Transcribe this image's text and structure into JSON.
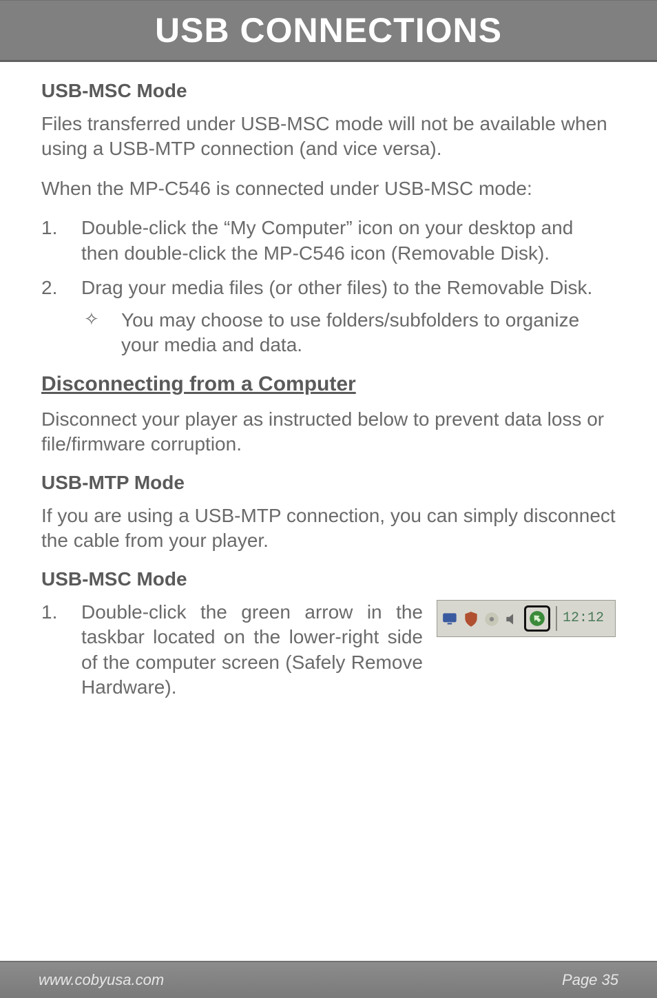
{
  "header": {
    "title": "USB CONNECTIONS"
  },
  "sections": {
    "usb_msc_mode_1": {
      "heading": "USB-MSC Mode",
      "p1": "Files transferred under USB-MSC mode will not be available when using a USB-MTP connection (and vice versa).",
      "p2": "When the MP-C546 is connected under USB-MSC mode:",
      "list": [
        {
          "num": "1.",
          "text": "Double-click the “My Computer” icon on your desktop and then double-click the MP-C546 icon (Removable Disk)."
        },
        {
          "num": "2.",
          "text": "Drag your media files (or other files) to the Removable Disk.",
          "sub": [
            {
              "bullet": "✧",
              "text": "You may choose to use folders/subfolders to organize your media and data."
            }
          ]
        }
      ]
    },
    "disconnecting": {
      "heading": "Disconnecting from a Computer",
      "p1": "Disconnect your player as instructed below to prevent data loss or file/firmware corruption."
    },
    "usb_mtp_mode": {
      "heading": "USB-MTP Mode",
      "p1": "If you are using a USB-MTP connection, you can simply disconnect the cable from your player."
    },
    "usb_msc_mode_2": {
      "heading": "USB-MSC Mode",
      "list": [
        {
          "num": "1.",
          "text": "Double-click the green arrow in the taskbar located on the lower-right side of the computer screen (Safely Remove Hardware)."
        }
      ]
    }
  },
  "tray": {
    "clock": "12:12"
  },
  "footer": {
    "left": "www.cobyusa.com",
    "right": "Page 35"
  }
}
